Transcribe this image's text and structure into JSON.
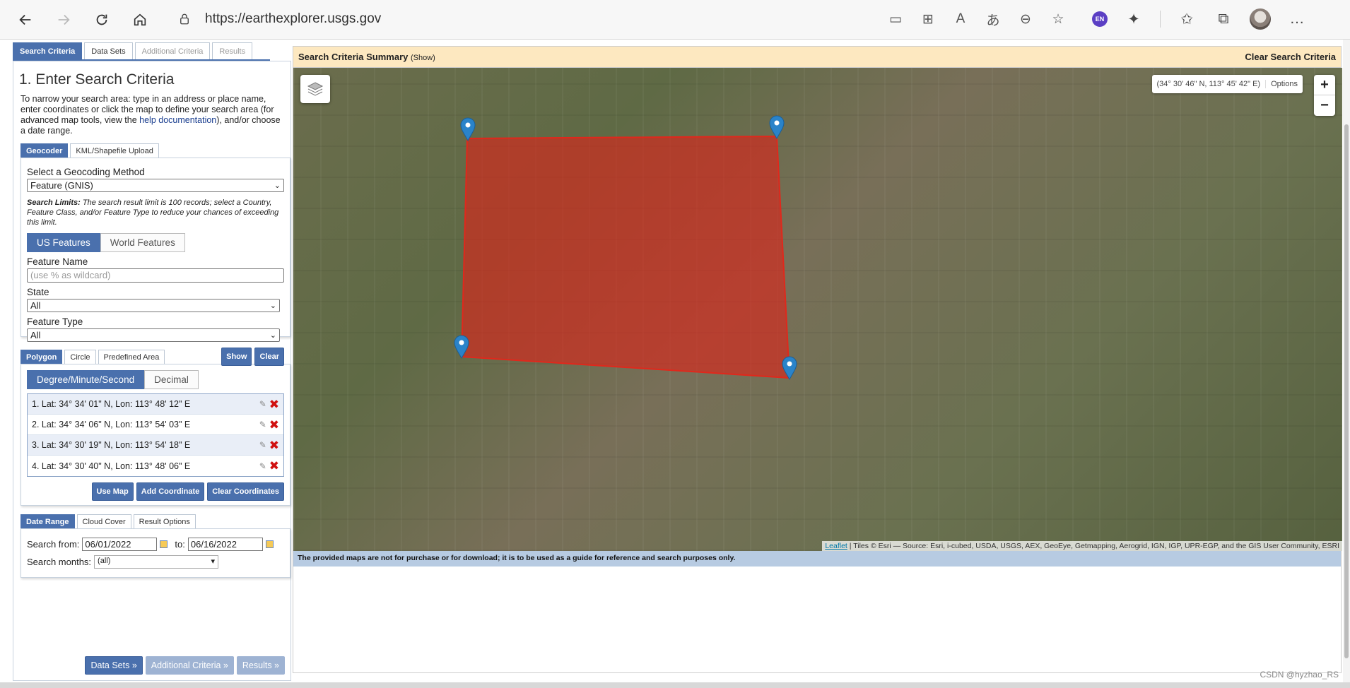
{
  "browser": {
    "url": "https://earthexplorer.usgs.gov",
    "profile_badge": "EN"
  },
  "main_tabs": [
    "Search Criteria",
    "Data Sets",
    "Additional Criteria",
    "Results"
  ],
  "heading": "1. Enter Search Criteria",
  "intro": {
    "text_before": "To narrow your search area: type in an address or place name, enter coordinates or click the map to define your search area (for advanced map tools, view the ",
    "link": "help documentation",
    "text_after": "), and/or choose a date range."
  },
  "geocoder": {
    "tabs": [
      "Geocoder",
      "KML/Shapefile Upload"
    ],
    "method_label": "Select a Geocoding Method",
    "method_value": "Feature (GNIS)",
    "limits_label": "Search Limits:",
    "limits_text": " The search result limit is 100 records; select a Country, Feature Class, and/or Feature Type to reduce your chances of exceeding this limit.",
    "feature_toggle": [
      "US Features",
      "World Features"
    ],
    "feature_name_label": "Feature Name",
    "feature_name_placeholder": "(use % as wildcard)",
    "state_label": "State",
    "state_value": "All",
    "feature_type_label": "Feature Type",
    "feature_type_value": "All",
    "show_label": "Show",
    "clear_label": "Clear"
  },
  "area": {
    "tabs": [
      "Polygon",
      "Circle",
      "Predefined Area"
    ],
    "format_toggle": [
      "Degree/Minute/Second",
      "Decimal"
    ],
    "coordinates": [
      "1.  Lat: 34° 34' 01\" N, Lon: 113° 48' 12\" E",
      "2.  Lat: 34° 34' 06\" N, Lon: 113° 54' 03\" E",
      "3.  Lat: 34° 30' 19\" N, Lon: 113° 54' 18\" E",
      "4.  Lat: 34° 30' 40\" N, Lon: 113° 48' 06\" E"
    ],
    "use_map": "Use Map",
    "add_coordinate": "Add Coordinate",
    "clear_coordinates": "Clear Coordinates"
  },
  "dates": {
    "tabs": [
      "Date Range",
      "Cloud Cover",
      "Result Options"
    ],
    "search_from_label": "Search from:",
    "from_value": "06/01/2022",
    "to_label": "to:",
    "to_value": "06/16/2022",
    "months_label": "Search months:",
    "months_value": "(all)"
  },
  "bottom_buttons": [
    "Data Sets »",
    "Additional Criteria »",
    "Results »"
  ],
  "map": {
    "summary_title": "Search Criteria Summary",
    "summary_show": "(Show)",
    "clear_criteria": "Clear Search Criteria",
    "coord_readout": "(34° 30' 46\" N, 113° 45' 42\" E)",
    "options_label": "Options",
    "zoom_in": "+",
    "zoom_out": "−",
    "attribution_link": "Leaflet",
    "attribution_text": " | Tiles © Esri — Source: Esri, i-cubed, USDA, USGS, AEX, GeoEye, Getmapping, Aerogrid, IGN, IGP, UPR-EGP, and the GIS User Community, ESRI",
    "disclaimer": "The provided maps are not for purchase or for download; it is to be used as a guide for reference and search purposes only.",
    "polygon_color": "#d9261c"
  },
  "watermark": "CSDN @hyzhao_RS"
}
